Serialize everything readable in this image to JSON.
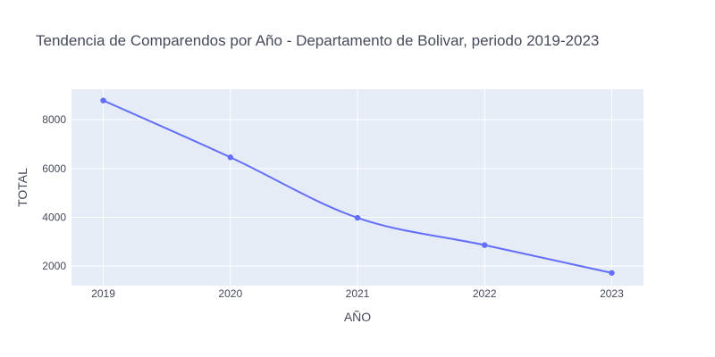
{
  "chart_data": {
    "type": "line",
    "title": "Tendencia de Comparendos por Año - Departamento de Bolivar, periodo 2019-2023",
    "xlabel": "AÑO",
    "ylabel": "TOTAL",
    "x": [
      "2019",
      "2020",
      "2021",
      "2022",
      "2023"
    ],
    "series": [
      {
        "values": [
          8790,
          6460,
          3980,
          2860,
          1720
        ]
      }
    ],
    "xlim": [
      2018.75,
      2023.25
    ],
    "ylim": [
      1200,
      9250
    ],
    "yticks": [
      2000,
      4000,
      6000,
      8000
    ],
    "ytick_labels": [
      "2000",
      "4000",
      "6000",
      "8000"
    ],
    "line_shape": "spline",
    "markers": true,
    "grid": true,
    "legend": "none",
    "colors": {
      "line": "#636efa",
      "plot_background": "#e5ecf6",
      "grid": "#ffffff",
      "text": "#444a5a"
    }
  }
}
